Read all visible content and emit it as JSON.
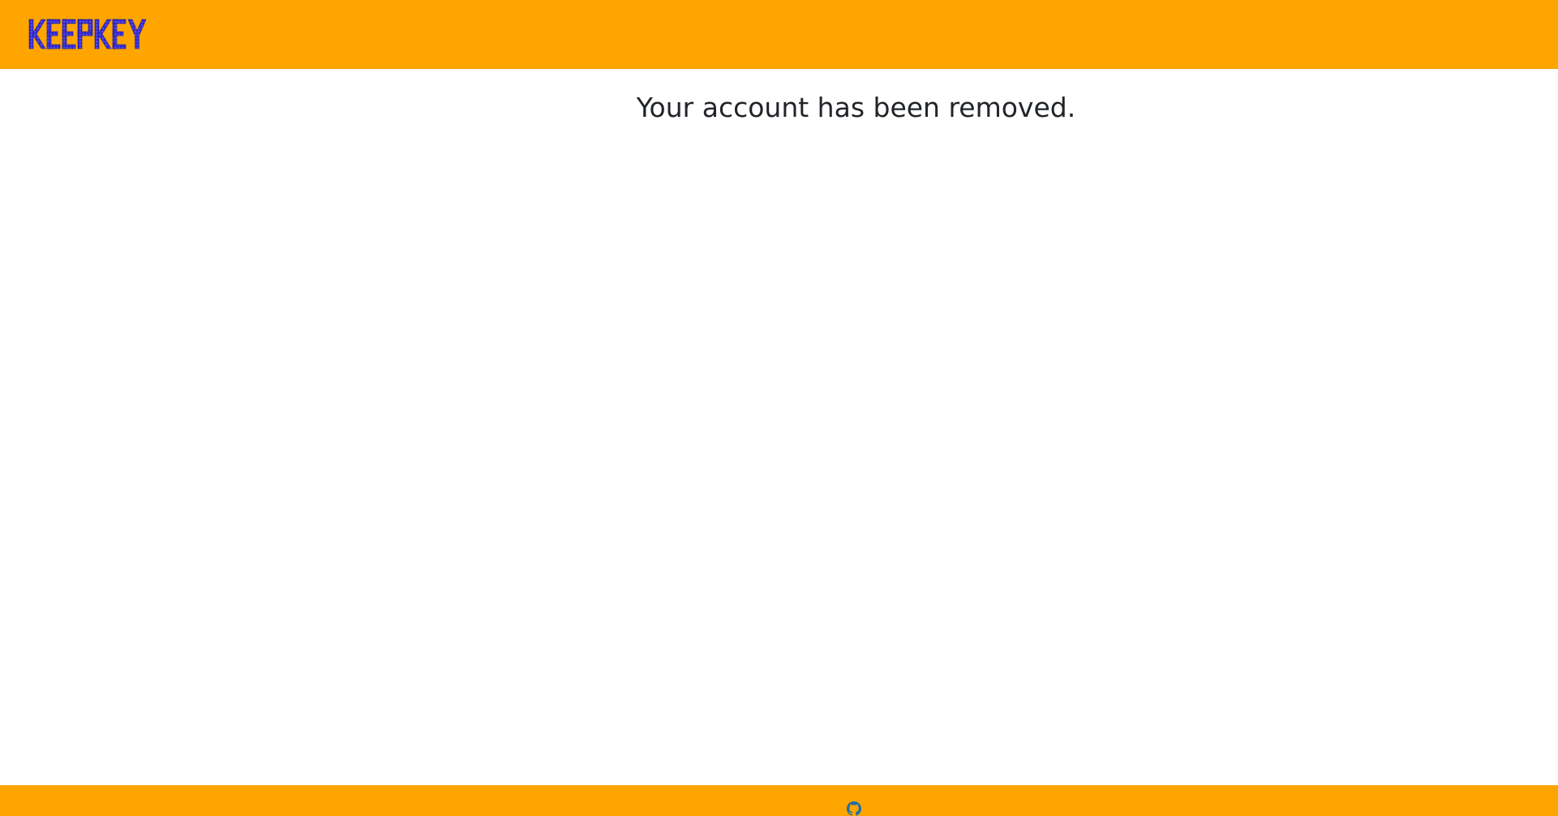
{
  "header": {
    "logo_text": "KEEPKEY",
    "logo_color": "#3a2fd6",
    "background_color": "#FFA500"
  },
  "main": {
    "message": "Your account has been removed."
  },
  "footer": {
    "background_color": "#FFA500",
    "link_icon": "github-icon",
    "link_color": "#1f6fa3"
  }
}
